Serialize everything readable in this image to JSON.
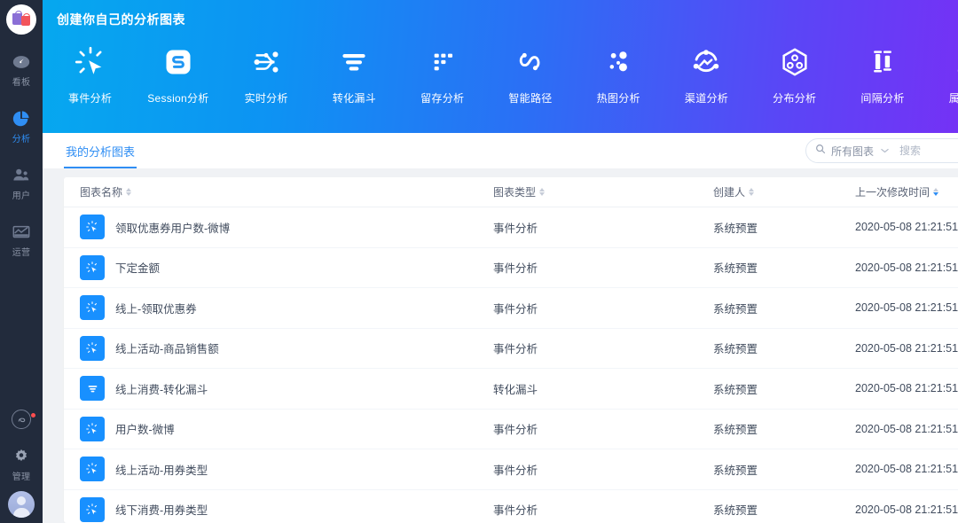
{
  "sidebar": {
    "logo_name": "shopping-bags-logo",
    "items": [
      {
        "label": "看板",
        "icon": "gauge-icon",
        "active": false
      },
      {
        "label": "分析",
        "icon": "pie-chart-icon",
        "active": true
      },
      {
        "label": "用户",
        "icon": "users-icon",
        "active": false
      },
      {
        "label": "运营",
        "icon": "chart-line-icon",
        "active": false
      }
    ],
    "bottom": [
      {
        "label": "",
        "icon": "mini-program-icon"
      },
      {
        "label": "管理",
        "icon": "gear-icon"
      }
    ],
    "avatar_name": "user-avatar",
    "avatar_badge": true
  },
  "banner": {
    "title": "创建你自己的分析图表",
    "gradient_from": "#06a8ef",
    "gradient_to": "#7d2bf5",
    "nav": [
      {
        "label": "事件分析",
        "icon": "click-burst-icon"
      },
      {
        "label": "Session分析",
        "icon": "session-s-icon"
      },
      {
        "label": "实时分析",
        "icon": "realtime-nodes-icon"
      },
      {
        "label": "转化漏斗",
        "icon": "funnel-icon"
      },
      {
        "label": "留存分析",
        "icon": "retention-blocks-icon"
      },
      {
        "label": "智能路径",
        "icon": "path-curve-icon"
      },
      {
        "label": "热图分析",
        "icon": "heatmap-dots-icon"
      },
      {
        "label": "渠道分析",
        "icon": "channel-circle-icon"
      },
      {
        "label": "分布分析",
        "icon": "hexagon-distribution-icon"
      },
      {
        "label": "间隔分析",
        "icon": "interval-bars-icon"
      },
      {
        "label": "属性分析",
        "icon": "attribute-people-icon"
      }
    ]
  },
  "tabs": [
    {
      "label": "我的分析图表",
      "active": true
    }
  ],
  "search": {
    "icon": "search-icon",
    "scope_label": "所有图表",
    "chevron": "chevron-down-icon",
    "placeholder": "搜索",
    "value": ""
  },
  "table": {
    "columns": [
      {
        "key": "name",
        "label": "图表名称",
        "sorted": false
      },
      {
        "key": "type",
        "label": "图表类型",
        "sorted": false
      },
      {
        "key": "owner",
        "label": "创建人",
        "sorted": false
      },
      {
        "key": "date",
        "label": "上一次修改时间",
        "sorted": true,
        "direction": "desc"
      }
    ],
    "rows": [
      {
        "icon": "click-burst-icon",
        "name": "领取优惠券用户数-微博",
        "type": "事件分析",
        "owner": "系统预置",
        "date": "2020-05-08 21:21:51"
      },
      {
        "icon": "click-burst-icon",
        "name": "下定金额",
        "type": "事件分析",
        "owner": "系统预置",
        "date": "2020-05-08 21:21:51"
      },
      {
        "icon": "click-burst-icon",
        "name": "线上-领取优惠券",
        "type": "事件分析",
        "owner": "系统预置",
        "date": "2020-05-08 21:21:51"
      },
      {
        "icon": "click-burst-icon",
        "name": "线上活动-商品销售额",
        "type": "事件分析",
        "owner": "系统预置",
        "date": "2020-05-08 21:21:51"
      },
      {
        "icon": "funnel-icon",
        "name": "线上消费-转化漏斗",
        "type": "转化漏斗",
        "owner": "系统预置",
        "date": "2020-05-08 21:21:51"
      },
      {
        "icon": "click-burst-icon",
        "name": "用户数-微博",
        "type": "事件分析",
        "owner": "系统预置",
        "date": "2020-05-08 21:21:51"
      },
      {
        "icon": "click-burst-icon",
        "name": "线上活动-用券类型",
        "type": "事件分析",
        "owner": "系统预置",
        "date": "2020-05-08 21:21:51"
      },
      {
        "icon": "click-burst-icon",
        "name": "线下消费-用券类型",
        "type": "事件分析",
        "owner": "系统预置",
        "date": "2020-05-08 21:21:51"
      }
    ]
  },
  "fab": {
    "icon": "whale-chat-icon"
  },
  "colors": {
    "accent": "#2f8ef4",
    "row_icon": "#1890ff",
    "sidebar_bg": "#222b3c"
  }
}
